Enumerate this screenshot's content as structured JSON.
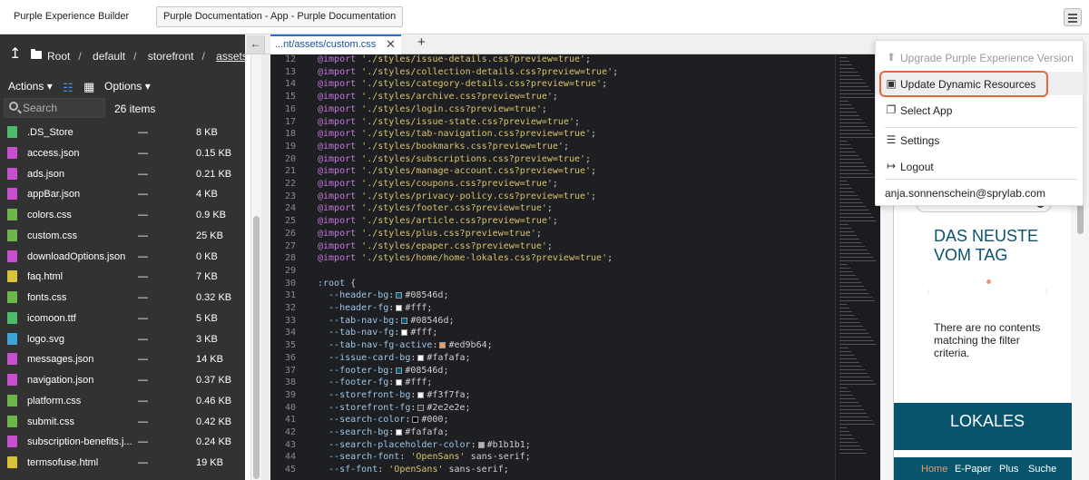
{
  "topbar": {
    "app_name": "Purple Experience Builder",
    "doc_button": "Purple Documentation - App - Purple Documentation",
    "menu_icon": "hamburger-icon"
  },
  "breadcrumb": {
    "items": [
      "Root",
      "default",
      "storefront",
      "assets"
    ],
    "separator": "/"
  },
  "toolbar": {
    "actions_label": "Actions",
    "options_label": "Options",
    "search_placeholder": "Search",
    "count": "26 items"
  },
  "files": [
    {
      "name": ".DS_Store",
      "size": "8 KB",
      "dash": "—",
      "icon_color": "#4cbb6a"
    },
    {
      "name": "access.json",
      "size": "0.15 KB",
      "dash": "—",
      "icon_color": "#c84fd0"
    },
    {
      "name": "ads.json",
      "size": "0.21 KB",
      "dash": "—",
      "icon_color": "#c84fd0"
    },
    {
      "name": "appBar.json",
      "size": "4 KB",
      "dash": "—",
      "icon_color": "#c84fd0"
    },
    {
      "name": "colors.css",
      "size": "0.9 KB",
      "dash": "—",
      "icon_color": "#6db64b"
    },
    {
      "name": "custom.css",
      "size": "25 KB",
      "dash": "—",
      "icon_color": "#6db64b"
    },
    {
      "name": "downloadOptions.json",
      "size": "0 KB",
      "dash": "—",
      "icon_color": "#c84fd0"
    },
    {
      "name": "faq.html",
      "size": "7 KB",
      "dash": "—",
      "icon_color": "#d9c23a"
    },
    {
      "name": "fonts.css",
      "size": "0.32 KB",
      "dash": "—",
      "icon_color": "#6db64b"
    },
    {
      "name": "icomoon.ttf",
      "size": "5 KB",
      "dash": "—",
      "icon_color": "#4cbb6a"
    },
    {
      "name": "logo.svg",
      "size": "3 KB",
      "dash": "—",
      "icon_color": "#3ba5d8"
    },
    {
      "name": "messages.json",
      "size": "14 KB",
      "dash": "—",
      "icon_color": "#c84fd0"
    },
    {
      "name": "navigation.json",
      "size": "0.37 KB",
      "dash": "—",
      "icon_color": "#c84fd0"
    },
    {
      "name": "platform.css",
      "size": "0.46 KB",
      "dash": "—",
      "icon_color": "#6db64b"
    },
    {
      "name": "submit.css",
      "size": "0.42 KB",
      "dash": "—",
      "icon_color": "#6db64b"
    },
    {
      "name": "subscription-benefits.j...",
      "size": "0.24 KB",
      "dash": "—",
      "icon_color": "#c84fd0"
    },
    {
      "name": "termsofuse.html",
      "size": "19 KB",
      "dash": "—",
      "icon_color": "#d9c23a"
    }
  ],
  "editor": {
    "tab_name": "...nt/assets/custom.css",
    "lines": [
      {
        "n": "12",
        "parts": [
          {
            "c": "kw",
            "t": "@import"
          },
          {
            "c": "str",
            "t": " './styles/issue-details.css?preview=true'"
          },
          {
            "c": "punc",
            "t": ";"
          }
        ]
      },
      {
        "n": "13",
        "parts": [
          {
            "c": "kw",
            "t": "@import"
          },
          {
            "c": "str",
            "t": " './styles/collection-details.css?preview=true'"
          },
          {
            "c": "punc",
            "t": ";"
          }
        ]
      },
      {
        "n": "14",
        "parts": [
          {
            "c": "kw",
            "t": "@import"
          },
          {
            "c": "str",
            "t": " './styles/category-details.css?preview=true'"
          },
          {
            "c": "punc",
            "t": ";"
          }
        ]
      },
      {
        "n": "15",
        "parts": [
          {
            "c": "kw",
            "t": "@import"
          },
          {
            "c": "str",
            "t": " './styles/archive.css?preview=true'"
          },
          {
            "c": "punc",
            "t": ";"
          }
        ]
      },
      {
        "n": "16",
        "parts": [
          {
            "c": "kw",
            "t": "@import"
          },
          {
            "c": "str",
            "t": " './styles/login.css?preview=true'"
          },
          {
            "c": "punc",
            "t": ";"
          }
        ]
      },
      {
        "n": "17",
        "parts": [
          {
            "c": "kw",
            "t": "@import"
          },
          {
            "c": "str",
            "t": " './styles/issue-state.css?preview=true'"
          },
          {
            "c": "punc",
            "t": ";"
          }
        ]
      },
      {
        "n": "18",
        "parts": [
          {
            "c": "kw",
            "t": "@import"
          },
          {
            "c": "str",
            "t": " './styles/tab-navigation.css?preview=true'"
          },
          {
            "c": "punc",
            "t": ";"
          }
        ]
      },
      {
        "n": "19",
        "parts": [
          {
            "c": "kw",
            "t": "@import"
          },
          {
            "c": "str",
            "t": " './styles/bookmarks.css?preview=true'"
          },
          {
            "c": "punc",
            "t": ";"
          }
        ]
      },
      {
        "n": "20",
        "parts": [
          {
            "c": "kw",
            "t": "@import"
          },
          {
            "c": "str",
            "t": " './styles/subscriptions.css?preview=true'"
          },
          {
            "c": "punc",
            "t": ";"
          }
        ]
      },
      {
        "n": "21",
        "parts": [
          {
            "c": "kw",
            "t": "@import"
          },
          {
            "c": "str",
            "t": " './styles/manage-account.css?preview=true'"
          },
          {
            "c": "punc",
            "t": ";"
          }
        ]
      },
      {
        "n": "22",
        "parts": [
          {
            "c": "kw",
            "t": "@import"
          },
          {
            "c": "str",
            "t": " './styles/coupons.css?preview=true'"
          },
          {
            "c": "punc",
            "t": ";"
          }
        ]
      },
      {
        "n": "23",
        "parts": [
          {
            "c": "kw",
            "t": "@import"
          },
          {
            "c": "str",
            "t": " './styles/privacy-policy.css?preview=true'"
          },
          {
            "c": "punc",
            "t": ";"
          }
        ]
      },
      {
        "n": "24",
        "parts": [
          {
            "c": "kw",
            "t": "@import"
          },
          {
            "c": "str",
            "t": " './styles/footer.css?preview=true'"
          },
          {
            "c": "punc",
            "t": ";"
          }
        ]
      },
      {
        "n": "25",
        "parts": [
          {
            "c": "kw",
            "t": "@import"
          },
          {
            "c": "str",
            "t": " './styles/article.css?preview=true'"
          },
          {
            "c": "punc",
            "t": ";"
          }
        ]
      },
      {
        "n": "26",
        "parts": [
          {
            "c": "kw",
            "t": "@import"
          },
          {
            "c": "str",
            "t": " './styles/plus.css?preview=true'"
          },
          {
            "c": "punc",
            "t": ";"
          }
        ]
      },
      {
        "n": "27",
        "parts": [
          {
            "c": "kw",
            "t": "@import"
          },
          {
            "c": "str",
            "t": " './styles/epaper.css?preview=true'"
          },
          {
            "c": "punc",
            "t": ";"
          }
        ]
      },
      {
        "n": "28",
        "parts": [
          {
            "c": "kw",
            "t": "@import"
          },
          {
            "c": "str",
            "t": " './styles/home/home-lokales.css?preview=true'"
          },
          {
            "c": "punc",
            "t": ";"
          }
        ]
      },
      {
        "n": "29",
        "parts": []
      },
      {
        "n": "30",
        "parts": [
          {
            "c": "var",
            "t": ":root"
          },
          {
            "c": "punc",
            "t": " {"
          }
        ]
      },
      {
        "n": "31",
        "parts": [
          {
            "c": "var",
            "t": "  --header-bg"
          },
          {
            "c": "punc",
            "t": ":"
          },
          {
            "c": "sw",
            "t": "#08546d"
          },
          {
            "c": "punc",
            "t": "#08546d;"
          }
        ]
      },
      {
        "n": "32",
        "parts": [
          {
            "c": "var",
            "t": "  --header-fg"
          },
          {
            "c": "punc",
            "t": ":"
          },
          {
            "c": "sw",
            "t": "#ffffff"
          },
          {
            "c": "punc",
            "t": "#fff;"
          }
        ]
      },
      {
        "n": "33",
        "parts": [
          {
            "c": "var",
            "t": "  --tab-nav-bg"
          },
          {
            "c": "punc",
            "t": ":"
          },
          {
            "c": "sw",
            "t": "#08546d"
          },
          {
            "c": "punc",
            "t": "#08546d;"
          }
        ]
      },
      {
        "n": "34",
        "parts": [
          {
            "c": "var",
            "t": "  --tab-nav-fg"
          },
          {
            "c": "punc",
            "t": ":"
          },
          {
            "c": "sw",
            "t": "#ffffff"
          },
          {
            "c": "punc",
            "t": "#fff;"
          }
        ]
      },
      {
        "n": "35",
        "parts": [
          {
            "c": "var",
            "t": "  --tab-nav-fg-active"
          },
          {
            "c": "punc",
            "t": ":"
          },
          {
            "c": "sw",
            "t": "#ed9b64"
          },
          {
            "c": "punc",
            "t": "#ed9b64;"
          }
        ]
      },
      {
        "n": "36",
        "parts": [
          {
            "c": "var",
            "t": "  --issue-card-bg"
          },
          {
            "c": "punc",
            "t": ":"
          },
          {
            "c": "sw",
            "t": "#fafafa"
          },
          {
            "c": "punc",
            "t": "#fafafa;"
          }
        ]
      },
      {
        "n": "37",
        "parts": [
          {
            "c": "var",
            "t": "  --footer-bg"
          },
          {
            "c": "punc",
            "t": ":"
          },
          {
            "c": "sw",
            "t": "#08546d"
          },
          {
            "c": "punc",
            "t": "#08546d;"
          }
        ]
      },
      {
        "n": "38",
        "parts": [
          {
            "c": "var",
            "t": "  --footer-fg"
          },
          {
            "c": "punc",
            "t": ":"
          },
          {
            "c": "sw",
            "t": "#ffffff"
          },
          {
            "c": "punc",
            "t": "#fff;"
          }
        ]
      },
      {
        "n": "39",
        "parts": [
          {
            "c": "var",
            "t": "  --storefront-bg"
          },
          {
            "c": "punc",
            "t": ":"
          },
          {
            "c": "sw",
            "t": "#f3f7fa"
          },
          {
            "c": "punc",
            "t": "#f3f7fa;"
          }
        ]
      },
      {
        "n": "40",
        "parts": [
          {
            "c": "var",
            "t": "  --storefront-fg"
          },
          {
            "c": "punc",
            "t": ":"
          },
          {
            "c": "sw",
            "t": "#2e2e2e"
          },
          {
            "c": "punc",
            "t": "#2e2e2e;"
          }
        ]
      },
      {
        "n": "41",
        "parts": [
          {
            "c": "var",
            "t": "  --search-color"
          },
          {
            "c": "punc",
            "t": ":"
          },
          {
            "c": "sw",
            "t": "#000000"
          },
          {
            "c": "punc",
            "t": "#000;"
          }
        ]
      },
      {
        "n": "42",
        "parts": [
          {
            "c": "var",
            "t": "  --search-bg"
          },
          {
            "c": "punc",
            "t": ":"
          },
          {
            "c": "sw",
            "t": "#fafafa"
          },
          {
            "c": "punc",
            "t": "#fafafa;"
          }
        ]
      },
      {
        "n": "43",
        "parts": [
          {
            "c": "var",
            "t": "  --search-placeholder-color"
          },
          {
            "c": "punc",
            "t": ":"
          },
          {
            "c": "sw",
            "t": "#b1b1b1"
          },
          {
            "c": "punc",
            "t": "#b1b1b1;"
          }
        ]
      },
      {
        "n": "44",
        "parts": [
          {
            "c": "var",
            "t": "  --search-font"
          },
          {
            "c": "punc",
            "t": ":"
          },
          {
            "c": "str",
            "t": " 'OpenSans'"
          },
          {
            "c": "punc",
            "t": " sans-serif;"
          }
        ]
      },
      {
        "n": "45",
        "parts": [
          {
            "c": "var",
            "t": "  --sf-font"
          },
          {
            "c": "punc",
            "t": ":"
          },
          {
            "c": "str",
            "t": " 'OpenSans'"
          },
          {
            "c": "punc",
            "t": " sans-serif;"
          }
        ]
      }
    ]
  },
  "menu": {
    "items": [
      {
        "label": "Upgrade Purple Experience Version",
        "icon": "upgrade-icon",
        "glyph": "⬆",
        "disabled": true
      },
      {
        "label": "Update Dynamic Resources",
        "icon": "update-resources-icon",
        "glyph": "▣",
        "disabled": false
      },
      {
        "label": "Select App",
        "icon": "select-app-icon",
        "glyph": "❐",
        "disabled": false
      },
      {
        "label": "Settings",
        "icon": "sliders-icon",
        "glyph": "☰",
        "disabled": false
      },
      {
        "label": "Logout",
        "icon": "logout-icon",
        "glyph": "↦",
        "disabled": false
      }
    ],
    "user_email": "anja.sonnenschein@sprylab.com",
    "highlight_color": "#e8663d"
  },
  "preview": {
    "headline_1": "DAS NEUSTE",
    "headline_2": "VOM TAG",
    "empty_line_1": "There are no contents",
    "empty_line_2": "matching the filter",
    "empty_line_3": "criteria.",
    "section_title": "LOKALES",
    "nav": [
      "Home",
      "E-Paper",
      "Plus",
      "Suche"
    ],
    "brand_color": "#08546d",
    "accent_color": "#ed9b64"
  }
}
